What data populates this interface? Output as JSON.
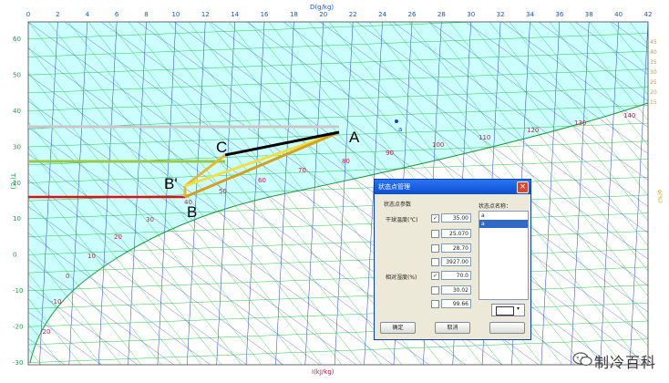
{
  "chart": {
    "top_axis_title": "D(g/kg)",
    "bottom_axis_title": "I(kJ/kg)",
    "left_axis_title": "T(℃)",
    "right_axis_title": "φ(%)",
    "top_ticks": [
      "0",
      "2",
      "4",
      "6",
      "8",
      "10",
      "12",
      "14",
      "16",
      "18",
      "20",
      "22",
      "24",
      "26",
      "28",
      "30",
      "32",
      "34",
      "36",
      "38",
      "40",
      "42"
    ],
    "left_ticks": [
      "60",
      "50",
      "40",
      "30",
      "20",
      "10",
      "0",
      "-10",
      "-20",
      "-30"
    ],
    "right_ticks": [
      "45",
      "40",
      "35",
      "30",
      "25",
      "20",
      "15"
    ],
    "enthalpy_labels": [
      "140",
      "130",
      "120",
      "110",
      "100",
      "90",
      "80",
      "70",
      "60",
      "50",
      "40",
      "30",
      "20",
      "10",
      "0",
      "-10",
      "-20"
    ],
    "point_labels": [
      "A",
      "C",
      "B'",
      "B"
    ],
    "state_point_marker": "a",
    "colors": {
      "background": "#ccffff",
      "grid_green": "#28c84a",
      "grid_blue": "#2a3bd6",
      "red": "#dd1111",
      "black": "#000000",
      "gold": "#e8b828",
      "yellow": "#f0e040"
    }
  },
  "dialog": {
    "title": "状态点管理",
    "section_label": "状态点参数",
    "name_label": "状态点名称：",
    "rows": [
      {
        "label": "干球温度(℃)",
        "checked": "✓",
        "value": "35.00"
      },
      {
        "label": "",
        "checked": "",
        "value": "25.070"
      },
      {
        "label": "",
        "checked": "",
        "value": "28.70"
      },
      {
        "label": "",
        "checked": "",
        "value": "3927.00"
      },
      {
        "label": "相对湿度(%)",
        "checked": "✓",
        "value": "70.0"
      },
      {
        "label": "",
        "checked": "",
        "value": "30.02"
      },
      {
        "label": "",
        "checked": "",
        "value": "99.66"
      }
    ],
    "list_items": [
      "a",
      "a"
    ],
    "ok_label": "确定",
    "cancel_label": "取消",
    "close_glyph": "×",
    "dropdown_glyph": "▾"
  },
  "watermark": {
    "text": "制冷百科"
  }
}
